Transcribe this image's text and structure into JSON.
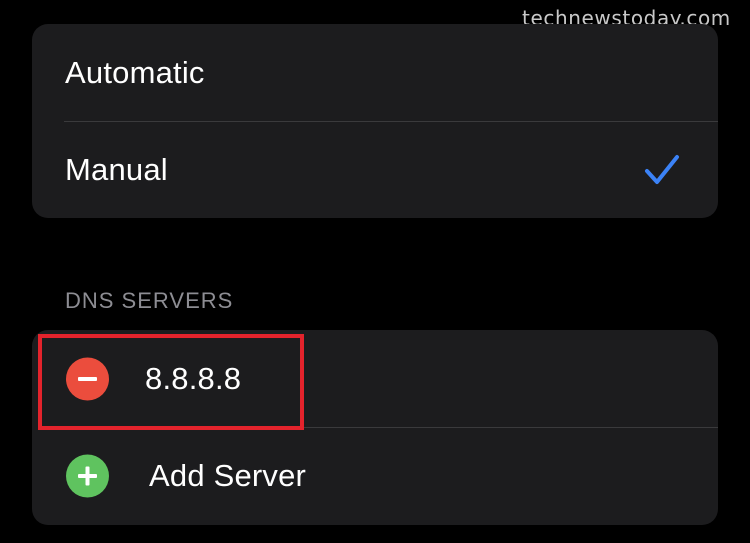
{
  "watermark": "technewstoday.com",
  "mode_options": [
    {
      "label": "Automatic",
      "selected": false
    },
    {
      "label": "Manual",
      "selected": true
    }
  ],
  "dns": {
    "header": "DNS SERVERS",
    "servers": [
      "8.8.8.8"
    ],
    "add_label": "Add Server"
  },
  "colors": {
    "background": "#000000",
    "card": "#1c1c1e",
    "separator": "#3a3a3c",
    "accent_blue": "#3b82f6",
    "delete_red": "#eb4d3d",
    "add_green": "#5fc35f",
    "highlight": "#e3232c"
  },
  "icons": {
    "selected": "checkmark-icon",
    "remove": "minus-circle-icon",
    "add": "plus-circle-icon"
  }
}
